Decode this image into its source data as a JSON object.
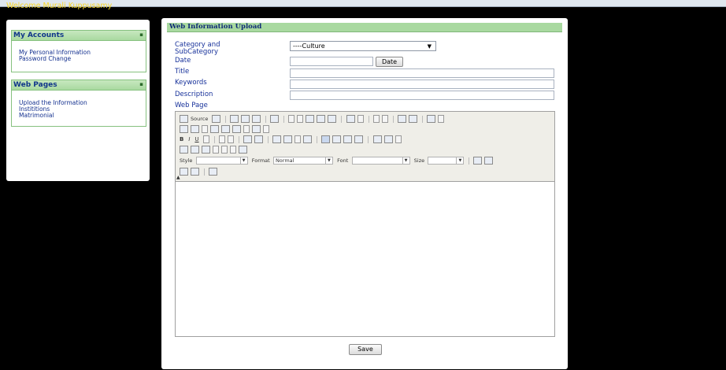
{
  "header": {
    "welcome": "Welcome Murali Kuppusamy"
  },
  "sidebar": {
    "accounts": {
      "title": "My Accounts",
      "items": [
        "My Personal Information",
        "Password Change"
      ]
    },
    "webpages": {
      "title": "Web Pages",
      "items": [
        "Upload the Information",
        "Instititions",
        "Matrimonial"
      ]
    }
  },
  "form": {
    "title": "Web Information Upload",
    "category_label": "Category and SubCategory",
    "category_value": "----Culture",
    "date_label": "Date",
    "date_button": "Date",
    "title_label": "Title",
    "keywords_label": "Keywords",
    "description_label": "Description",
    "webpage_label": "Web Page",
    "save_button": "Save"
  },
  "editor": {
    "source_label": "Source",
    "style_label": "Style",
    "format_label": "Format",
    "format_value": "Normal",
    "font_label": "Font",
    "size_label": "Size"
  }
}
